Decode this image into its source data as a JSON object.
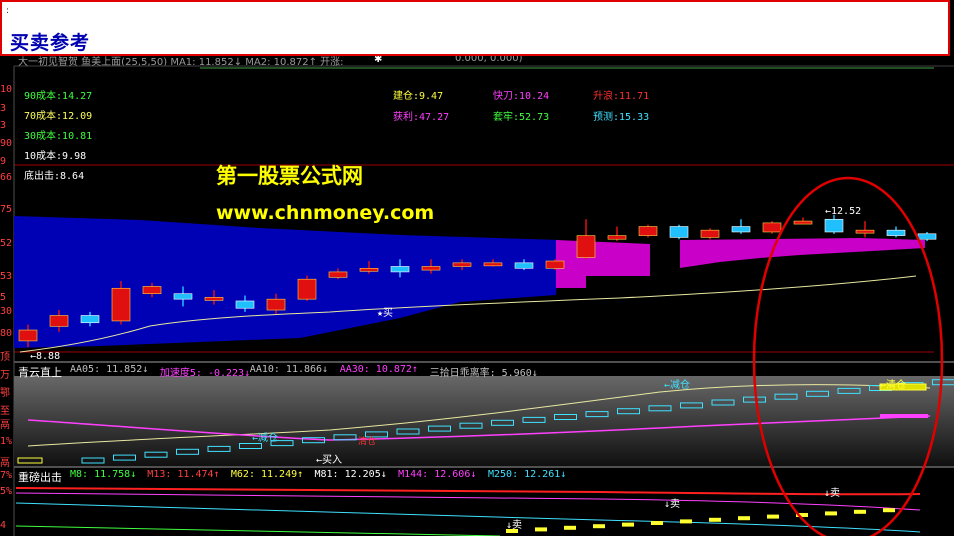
{
  "banner": {
    "title": "买卖参考",
    "mark": ":"
  },
  "topstrip": {
    "indicator_name": "大一初见智贺 鱼美上面(25,5,50) MA1: 11.852↓ MA2: 10.872↑ 开涨:",
    "star": "✱",
    "values": "0.000, 0.000)"
  },
  "left_axis": [
    "10",
    "3",
    "3",
    "90",
    "9",
    "66",
    "75",
    "52",
    "53",
    "5",
    "30",
    "80",
    "顶",
    "万",
    "鄂",
    "至",
    "鬲",
    "1%",
    "鬲",
    "7%",
    "5%",
    "4"
  ],
  "cost_legend": [
    {
      "label": "90成本:14.27",
      "color": "#40ff40"
    },
    {
      "label": "70成本:12.09",
      "color": "#ffff60"
    },
    {
      "label": "30成本:10.81",
      "color": "#40ff40"
    },
    {
      "label": "10成本:9.98",
      "color": "#ffffff"
    },
    {
      "label": "底出击:8.64",
      "color": "#ffffff"
    }
  ],
  "stats": [
    {
      "label": "建仓:9.47",
      "color": "#ffff40"
    },
    {
      "label": "快刀:10.24",
      "color": "#ff40ff"
    },
    {
      "label": "升浪:11.71",
      "color": "#ff3030"
    },
    {
      "label": "获利:47.27",
      "color": "#ff40ff"
    },
    {
      "label": "套牢:52.73",
      "color": "#40ff40"
    },
    {
      "label": "预测:15.33",
      "color": "#40e0ff"
    }
  ],
  "watermark": {
    "line1": "第一股票公式网",
    "line2": "www.chnmoney.com"
  },
  "main_annotations": {
    "buy": "★买",
    "low": "←8.88",
    "high": "←12.52"
  },
  "indicator1": {
    "title": "青云直上",
    "fields": [
      {
        "text": "AA05: 11.852↓",
        "color": "#c0c0c0"
      },
      {
        "text": "加速度5: -0.223↓",
        "color": "#ff40ff"
      },
      {
        "text": "AA10: 11.866↓",
        "color": "#c0c0c0"
      },
      {
        "text": "AA30: 10.872↑",
        "color": "#ff40ff"
      },
      {
        "text": "三拾日乖离率: 5.960↓",
        "color": "#c0c0c0"
      }
    ],
    "signals": {
      "reduce1": "←减仓",
      "reduce2": "←减仓",
      "buy": "←买入",
      "clear": "←清仓",
      "tag": "清仓"
    }
  },
  "indicator2": {
    "title": "重磅出击",
    "fields": [
      {
        "text": "M8: 11.758↓",
        "color": "#40ff40"
      },
      {
        "text": "M13: 11.474↑",
        "color": "#ff4040"
      },
      {
        "text": "M62: 11.249↑",
        "color": "#ffff40"
      },
      {
        "text": "M81: 12.205↓",
        "color": "#ffffff"
      },
      {
        "text": "M144: 12.606↓",
        "color": "#ff40ff"
      },
      {
        "text": "M250: 12.261↓",
        "color": "#40e0ff"
      }
    ],
    "signals": {
      "sell1": "↓卖",
      "sell2": "↓卖",
      "sell3": "↓卖"
    }
  },
  "colors": {
    "up": "#e01010",
    "down": "#20c0ff",
    "blue_band": "#0000b4",
    "magenta_band": "#c800c8",
    "ellipse": "#e00000",
    "divider": "#a00000"
  },
  "candles": [
    {
      "o": 9.05,
      "c": 9.35,
      "h": 9.5,
      "l": 8.88
    },
    {
      "o": 9.45,
      "c": 9.75,
      "h": 9.9,
      "l": 9.3
    },
    {
      "o": 9.75,
      "c": 9.55,
      "h": 9.85,
      "l": 9.45
    },
    {
      "o": 9.6,
      "c": 10.5,
      "h": 10.7,
      "l": 9.5
    },
    {
      "o": 10.35,
      "c": 10.55,
      "h": 10.65,
      "l": 10.25
    },
    {
      "o": 10.35,
      "c": 10.2,
      "h": 10.55,
      "l": 10.0
    },
    {
      "o": 10.25,
      "c": 10.25,
      "h": 10.45,
      "l": 10.05
    },
    {
      "o": 10.15,
      "c": 9.95,
      "h": 10.3,
      "l": 9.85
    },
    {
      "o": 9.9,
      "c": 10.2,
      "h": 10.35,
      "l": 9.8
    },
    {
      "o": 10.2,
      "c": 10.75,
      "h": 10.85,
      "l": 10.15
    },
    {
      "o": 10.8,
      "c": 10.95,
      "h": 11.05,
      "l": 10.75
    },
    {
      "o": 11.05,
      "c": 11.05,
      "h": 11.25,
      "l": 10.9
    },
    {
      "o": 11.1,
      "c": 10.95,
      "h": 11.3,
      "l": 10.8
    },
    {
      "o": 11.0,
      "c": 11.1,
      "h": 11.3,
      "l": 10.9
    },
    {
      "o": 11.1,
      "c": 11.2,
      "h": 11.3,
      "l": 11.0
    },
    {
      "o": 11.2,
      "c": 11.2,
      "h": 11.3,
      "l": 11.1
    },
    {
      "o": 11.2,
      "c": 11.05,
      "h": 11.3,
      "l": 11.0
    },
    {
      "o": 11.05,
      "c": 11.25,
      "h": 11.3,
      "l": 11.0
    },
    {
      "o": 11.35,
      "c": 11.95,
      "h": 12.4,
      "l": 11.3
    },
    {
      "o": 11.85,
      "c": 11.95,
      "h": 12.2,
      "l": 11.8
    },
    {
      "o": 11.95,
      "c": 12.2,
      "h": 12.25,
      "l": 11.9
    },
    {
      "o": 12.2,
      "c": 11.9,
      "h": 12.25,
      "l": 11.85
    },
    {
      "o": 11.9,
      "c": 12.1,
      "h": 12.15,
      "l": 11.85
    },
    {
      "o": 12.2,
      "c": 12.05,
      "h": 12.4,
      "l": 12.0
    },
    {
      "o": 12.05,
      "c": 12.3,
      "h": 12.35,
      "l": 12.0
    },
    {
      "o": 12.3,
      "c": 12.35,
      "h": 12.45,
      "l": 12.3
    },
    {
      "o": 12.4,
      "c": 12.05,
      "h": 12.52,
      "l": 12.0
    },
    {
      "o": 12.1,
      "c": 12.1,
      "h": 12.35,
      "l": 11.9
    },
    {
      "o": 12.1,
      "c": 11.95,
      "h": 12.2,
      "l": 11.9
    },
    {
      "o": 12.0,
      "c": 11.85,
      "h": 12.05,
      "l": 11.8
    }
  ]
}
